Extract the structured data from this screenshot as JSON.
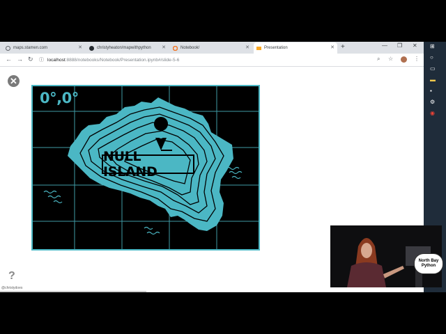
{
  "browser": {
    "tabs": [
      {
        "label": "maps.stamen.com",
        "active": false
      },
      {
        "label": "christyheaton/mapwithpython",
        "active": false
      },
      {
        "label": "Notebook/",
        "active": false
      },
      {
        "label": "Presentation",
        "active": true
      }
    ],
    "new_tab": "+",
    "url_host": "localhost",
    "url_path": ":8888/notebooks/Notebook/Presentation.ipynb#/slide-5-6"
  },
  "slide": {
    "coordinate": "0°,0°",
    "island_label": "NULL ISLAND",
    "colors": {
      "accent": "#4bb7c4",
      "background": "#000000"
    }
  },
  "page": {
    "help_glyph": "?",
    "twitter_handle": "@christydoes"
  },
  "webcam": {
    "bubble_line1": "North Bay",
    "bubble_line2": "Python"
  }
}
